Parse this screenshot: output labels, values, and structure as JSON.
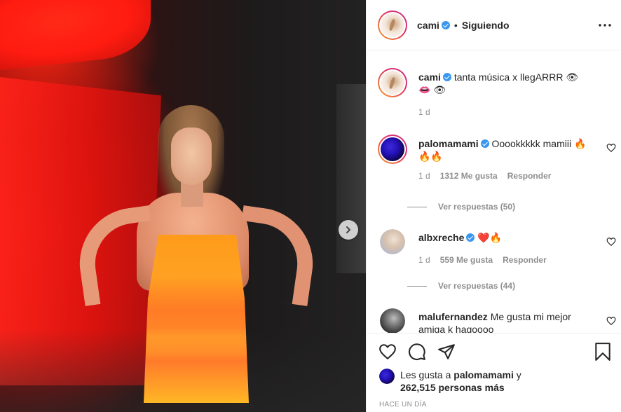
{
  "post": {
    "author": "cami",
    "verified": true,
    "follow_status": "Siguiendo",
    "separator": "•"
  },
  "caption": {
    "username": "cami",
    "text": "tanta música x llegARRR 👁 👄 👁",
    "time": "1 d"
  },
  "comments": [
    {
      "username": "palomamami",
      "verified": true,
      "text": "Ooookkkkk mamiii 🔥🔥🔥",
      "time": "1 d",
      "likes": "1312 Me gusta",
      "reply_label": "Responder",
      "view_replies": "Ver respuestas (50)"
    },
    {
      "username": "albxreche",
      "verified": true,
      "text": "❤️🔥",
      "time": "1 d",
      "likes": "559 Me gusta",
      "reply_label": "Responder",
      "view_replies": "Ver respuestas (44)"
    },
    {
      "username": "malufernandez",
      "verified": false,
      "text": "Me gusta mi mejor amiga k hagoooo"
    }
  ],
  "likes_summary": {
    "prefix": "Les gusta a",
    "liker": "palomamami",
    "connector": "y",
    "others": "262,515 personas más"
  },
  "timestamp": "HACE UN DÍA",
  "icons": {
    "more": "more-options-icon",
    "like": "heart-icon",
    "comment": "comment-icon",
    "share": "share-icon",
    "save": "bookmark-icon",
    "next": "chevron-right-icon"
  },
  "colors": {
    "text": "#262626",
    "muted": "#8e8e8e",
    "verified": "#3897f0",
    "border": "#efefef"
  }
}
